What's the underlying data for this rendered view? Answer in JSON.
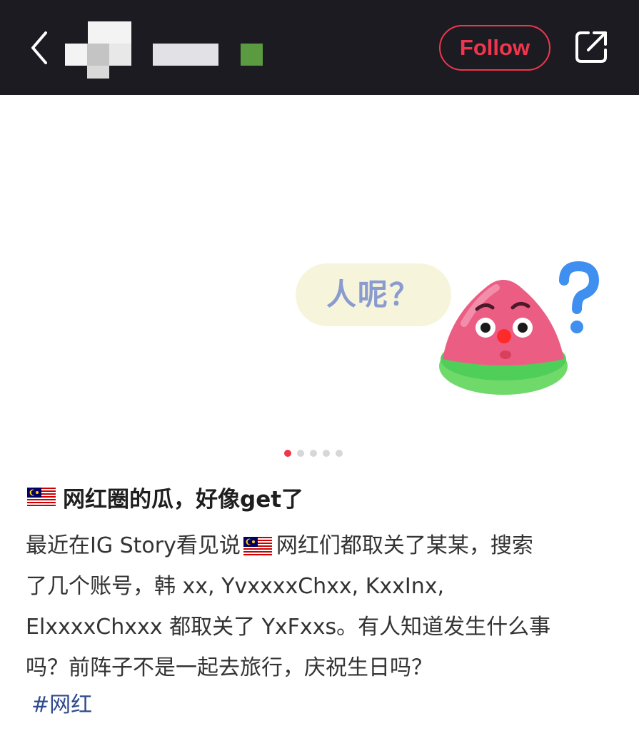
{
  "header": {
    "back_icon": "chevron-left-icon",
    "follow_label": "Follow",
    "share_icon": "share-external-icon",
    "bar_color": "#1c1b22",
    "accent": "#f0364d"
  },
  "media": {
    "bubble_text": "人呢？",
    "sticker_icon": "watermelon-question-sticker",
    "carousel": {
      "count": 5,
      "active_index": 0
    }
  },
  "post": {
    "flag_icon": "malaysia-flag-icon",
    "title": "网红圈的瓜，好像get了",
    "body": {
      "line1_before_flag": "最近在IG Story看见说",
      "line1_after_flag": "网红们都取关了某某，搜索",
      "line2": "了几个账号，韩 xx, YvxxxxChxx, KxxInx,",
      "line3": "ElxxxxChxxx 都取关了 YxFxxs。有人知道发生什么事",
      "line4": "吗？前阵子不是一起去旅行，庆祝生日吗？"
    },
    "hashtag": "#网红"
  }
}
